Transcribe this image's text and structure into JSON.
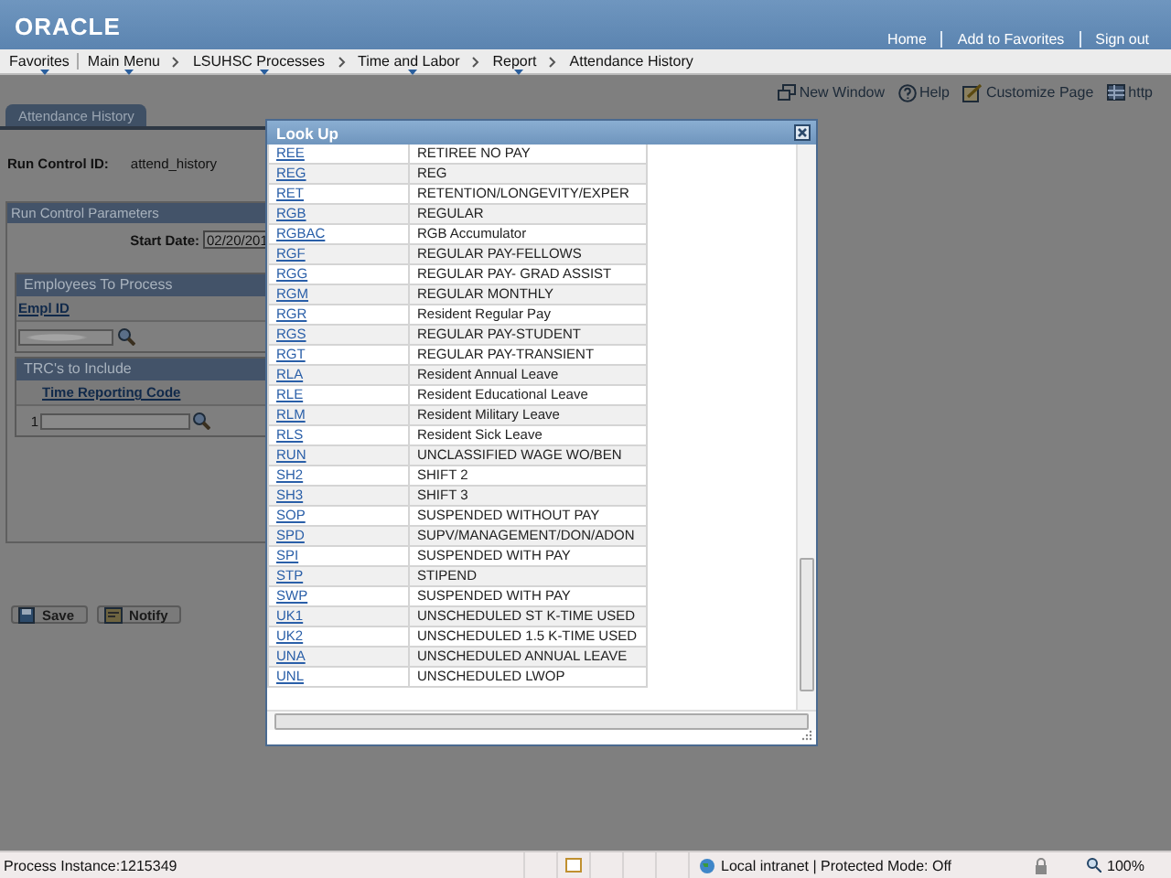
{
  "header": {
    "logo": "ORACLE",
    "links": [
      "Home",
      "Add to Favorites",
      "Sign out"
    ]
  },
  "breadcrumbs": [
    {
      "label": "Favorites",
      "dropdown": true
    },
    {
      "label": "Main Menu",
      "dropdown": true
    },
    {
      "label": "LSUHSC Processes",
      "dropdown": true
    },
    {
      "label": "Time and Labor",
      "dropdown": true
    },
    {
      "label": "Report",
      "dropdown": true
    },
    {
      "label": "Attendance History",
      "dropdown": false
    }
  ],
  "toolbar": [
    {
      "kind": "window",
      "label": "New Window"
    },
    {
      "kind": "help",
      "label": "Help"
    },
    {
      "kind": "customize",
      "label": "Customize Page"
    },
    {
      "kind": "link",
      "label": "http"
    }
  ],
  "tab": {
    "label": "Attendance History",
    "selected": true
  },
  "form": {
    "run_control_label": "Run Control ID:",
    "run_control_value": "attend_history",
    "panel_title": "Run Control Parameters",
    "start_date_label": "Start Date:",
    "start_date_value": "02/20/201",
    "employees": {
      "title": "Employees To Process",
      "column": "Empl ID"
    },
    "trc": {
      "title": "TRC's to Include",
      "column": "Time Reporting Code",
      "row_number": "1"
    }
  },
  "buttons": [
    {
      "kind": "save",
      "label": "Save"
    },
    {
      "kind": "notify",
      "label": "Notify"
    }
  ],
  "lookup": {
    "title": "Look Up",
    "rows": [
      {
        "code": "REE",
        "description": "RETIREE NO PAY"
      },
      {
        "code": "REG",
        "description": "REG"
      },
      {
        "code": "RET",
        "description": "RETENTION/LONGEVITY/EXPER"
      },
      {
        "code": "RGB",
        "description": "REGULAR"
      },
      {
        "code": "RGBAC",
        "description": "RGB Accumulator"
      },
      {
        "code": "RGF",
        "description": "REGULAR PAY-FELLOWS"
      },
      {
        "code": "RGG",
        "description": "REGULAR PAY- GRAD ASSIST"
      },
      {
        "code": "RGM",
        "description": "REGULAR MONTHLY"
      },
      {
        "code": "RGR",
        "description": "Resident Regular Pay"
      },
      {
        "code": "RGS",
        "description": "REGULAR PAY-STUDENT"
      },
      {
        "code": "RGT",
        "description": "REGULAR PAY-TRANSIENT"
      },
      {
        "code": "RLA",
        "description": "Resident Annual Leave"
      },
      {
        "code": "RLE",
        "description": "Resident Educational Leave"
      },
      {
        "code": "RLM",
        "description": "Resident Military Leave"
      },
      {
        "code": "RLS",
        "description": "Resident Sick Leave"
      },
      {
        "code": "RUN",
        "description": "UNCLASSIFIED WAGE WO/BEN"
      },
      {
        "code": "SH2",
        "description": "SHIFT 2"
      },
      {
        "code": "SH3",
        "description": "SHIFT 3"
      },
      {
        "code": "SOP",
        "description": "SUSPENDED WITHOUT PAY"
      },
      {
        "code": "SPD",
        "description": "SUPV/MANAGEMENT/DON/ADON"
      },
      {
        "code": "SPI",
        "description": "SUSPENDED WITH PAY"
      },
      {
        "code": "STP",
        "description": "STIPEND"
      },
      {
        "code": "SWP",
        "description": "SUSPENDED WITH PAY"
      },
      {
        "code": "UK1",
        "description": "UNSCHEDULED ST K-TIME USED"
      },
      {
        "code": "UK2",
        "description": "UNSCHEDULED 1.5 K-TIME USED"
      },
      {
        "code": "UNA",
        "description": "UNSCHEDULED ANNUAL LEAVE"
      },
      {
        "code": "UNL",
        "description": "UNSCHEDULED LWOP"
      }
    ]
  },
  "status_bar": {
    "process": "Process Instance:1215349",
    "zone": "Local intranet | Protected Mode: Off",
    "zoom": "100%"
  }
}
